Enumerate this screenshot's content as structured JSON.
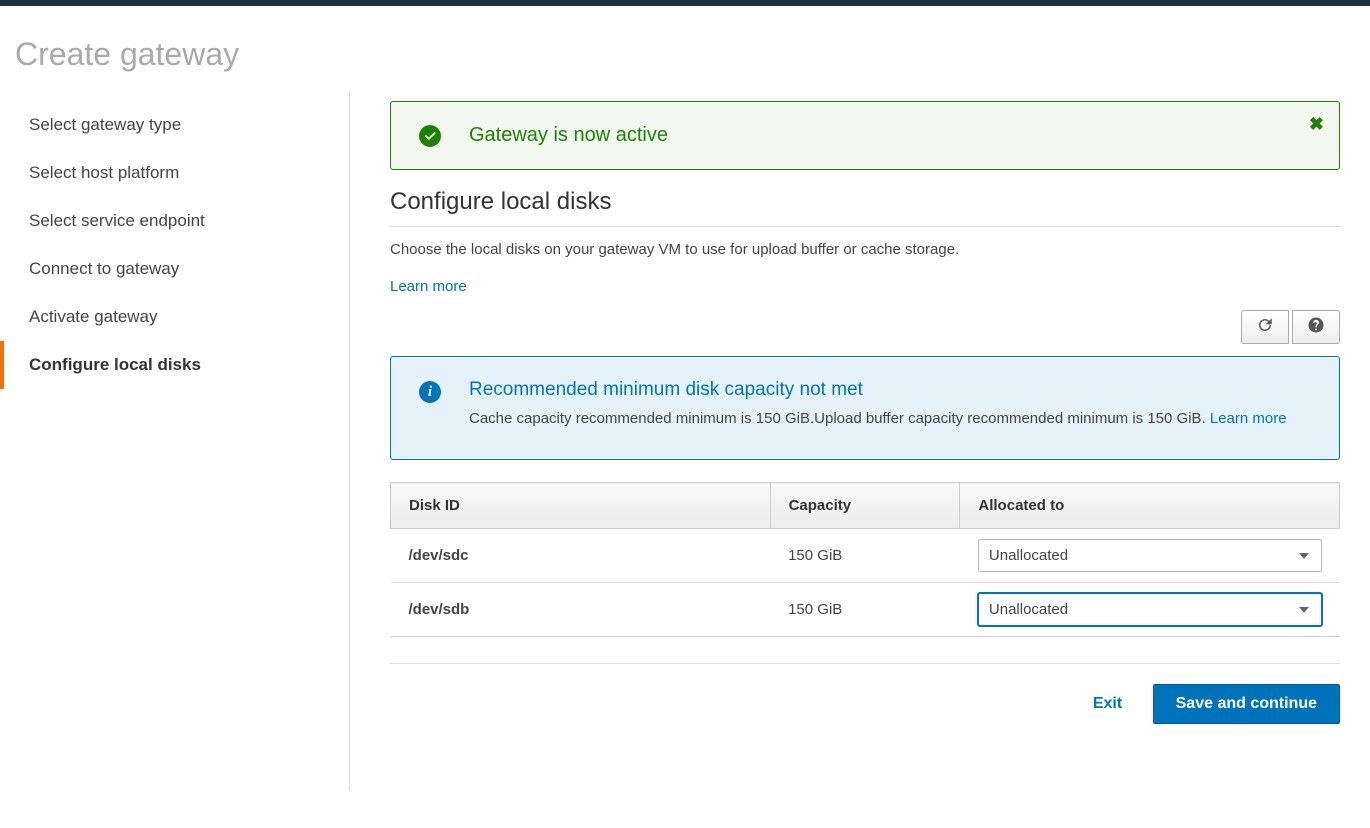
{
  "pageTitle": "Create gateway",
  "sidebar": {
    "items": [
      {
        "label": "Select gateway type"
      },
      {
        "label": "Select host platform"
      },
      {
        "label": "Select service endpoint"
      },
      {
        "label": "Connect to gateway"
      },
      {
        "label": "Activate gateway"
      },
      {
        "label": "Configure local disks"
      }
    ],
    "activeIndex": 5
  },
  "successAlert": {
    "message": "Gateway is now active"
  },
  "section": {
    "heading": "Configure local disks",
    "description": "Choose the local disks on your gateway VM to use for upload buffer or cache storage.",
    "learnMore": "Learn more"
  },
  "infoAlert": {
    "title": "Recommended minimum disk capacity not met",
    "body": "Cache capacity recommended minimum is 150 GiB.Upload buffer capacity recommended minimum is 150 GiB. ",
    "learnMore": "Learn more"
  },
  "table": {
    "headers": {
      "diskId": "Disk ID",
      "capacity": "Capacity",
      "allocatedTo": "Allocated to"
    },
    "rows": [
      {
        "diskId": "/dev/sdc",
        "capacity": "150 GiB",
        "allocatedTo": "Unallocated",
        "focused": false
      },
      {
        "diskId": "/dev/sdb",
        "capacity": "150 GiB",
        "allocatedTo": "Unallocated",
        "focused": true
      }
    ]
  },
  "actions": {
    "exit": "Exit",
    "save": "Save and continue"
  }
}
